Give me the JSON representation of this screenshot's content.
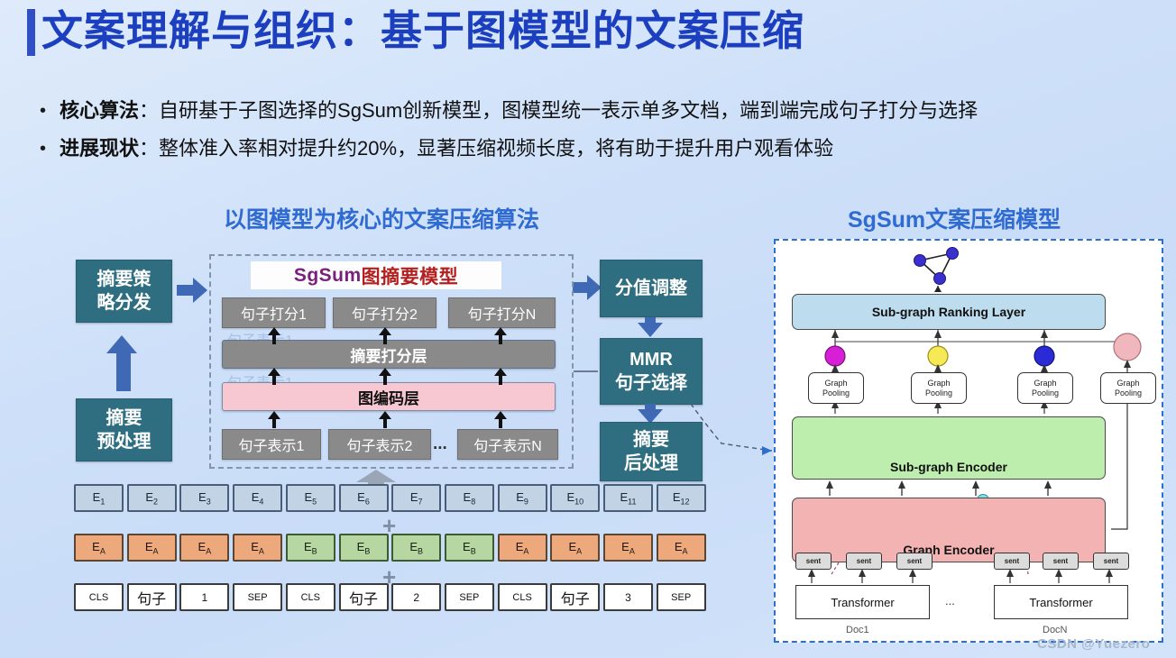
{
  "header": {
    "title": "文案理解与组织：基于图模型的文案压缩",
    "accent_color": "#1c3fc0"
  },
  "bullets": [
    {
      "marker": "•",
      "label": "核心算法",
      "sep": "：",
      "text": "自研基于子图选择的SgSum创新模型，图模型统一表示单多文档，端到端完成句子打分与选择"
    },
    {
      "marker": "•",
      "label": "进展现状",
      "sep": "：",
      "text": "整体准入率相对提升约20%，显著压缩视频长度，将有助于提升用户观看体验"
    }
  ],
  "left_diagram": {
    "caption": "以图模型为核心的文案压缩算法",
    "stage_boxes": [
      {
        "id": "strategy",
        "label": "摘要策\n略分发"
      },
      {
        "id": "preprocess",
        "label": "摘要\n预处理"
      }
    ],
    "strategy_line1": "摘要策",
    "strategy_line2": "略分发",
    "preprocess_line1": "摘要",
    "preprocess_line2": "预处理",
    "model": {
      "banner_prefix": "SgSum",
      "banner_suffix": "图摘要模型",
      "score_boxes": [
        "句子打分1",
        "句子打分2",
        "句子打分N"
      ],
      "scoring_layer": "摘要打分层",
      "graph_layer": "图编码层",
      "repr_boxes": [
        "句子表示1",
        "句子表示2",
        "句子表示N"
      ],
      "repr_ellipsis": "...",
      "ghost_text_1": "句子表示1",
      "ghost_text_2": "句子表示1"
    },
    "post_boxes": [
      {
        "id": "score-adjust",
        "label": "分值调整"
      },
      {
        "id": "mmr",
        "line1": "MMR",
        "line2": "句子选择"
      },
      {
        "id": "postprocess",
        "line1": "摘要",
        "line2": "后处理"
      }
    ],
    "tokens": {
      "embedding_row": [
        {
          "base": "E",
          "sub": "1"
        },
        {
          "base": "E",
          "sub": "2"
        },
        {
          "base": "E",
          "sub": "3"
        },
        {
          "base": "E",
          "sub": "4"
        },
        {
          "base": "E",
          "sub": "5"
        },
        {
          "base": "E",
          "sub": "6"
        },
        {
          "base": "E",
          "sub": "7"
        },
        {
          "base": "E",
          "sub": "8"
        },
        {
          "base": "E",
          "sub": "9"
        },
        {
          "base": "E",
          "sub": "10"
        },
        {
          "base": "E",
          "sub": "11"
        },
        {
          "base": "E",
          "sub": "12"
        }
      ],
      "segment_row": [
        {
          "base": "E",
          "sub": "A",
          "type": "A"
        },
        {
          "base": "E",
          "sub": "A",
          "type": "A"
        },
        {
          "base": "E",
          "sub": "A",
          "type": "A"
        },
        {
          "base": "E",
          "sub": "A",
          "type": "A"
        },
        {
          "base": "E",
          "sub": "B",
          "type": "B"
        },
        {
          "base": "E",
          "sub": "B",
          "type": "B"
        },
        {
          "base": "E",
          "sub": "B",
          "type": "B"
        },
        {
          "base": "E",
          "sub": "B",
          "type": "B"
        },
        {
          "base": "E",
          "sub": "A",
          "type": "A"
        },
        {
          "base": "E",
          "sub": "A",
          "type": "A"
        },
        {
          "base": "E",
          "sub": "A",
          "type": "A"
        },
        {
          "base": "E",
          "sub": "A",
          "type": "A"
        }
      ],
      "token_row": [
        "CLS",
        "句子",
        "1",
        "SEP",
        "CLS",
        "句子",
        "2",
        "SEP",
        "CLS",
        "句子",
        "3",
        "SEP"
      ],
      "plus_sign": "+"
    }
  },
  "right_diagram": {
    "caption": "SgSum文案压缩模型",
    "ranking_layer": "Sub-graph Ranking Layer",
    "pooling_label_line1": "Graph",
    "pooling_label_line2": "Pooling",
    "pooling_count": 4,
    "subgraph_encoder": "Sub-graph Encoder",
    "graph_encoder": "Graph Encoder",
    "sent_label": "sent",
    "transformer_label": "Transformer",
    "transformer_ellipsis": "...",
    "doc_labels": [
      "Doc1",
      "DocN"
    ],
    "colors": {
      "ranking_layer": "#bddcee",
      "subgraph_encoder": "#bdeeae",
      "graph_encoder": "#f4b3b3",
      "node_magenta": "#d61fd6",
      "node_yellow": "#f5ea55",
      "node_blue": "#2a2ad6",
      "node_pink": "#f0b8bc"
    }
  },
  "watermark": "CSDN @Yuezero"
}
